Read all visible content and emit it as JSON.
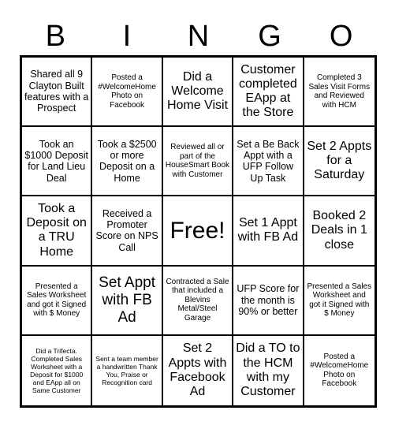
{
  "header": {
    "letters": [
      "B",
      "I",
      "N",
      "G",
      "O"
    ]
  },
  "grid": {
    "rows": 5,
    "columns": 5,
    "cells": [
      {
        "text": "Shared all 9 Clayton Built features with a Prospect",
        "size": "md"
      },
      {
        "text": "Posted a #WelcomeHome Photo on Facebook",
        "size": "sm"
      },
      {
        "text": "Did a Welcome Home Visit",
        "size": "lg"
      },
      {
        "text": "Customer completed EApp at the Store",
        "size": "lg"
      },
      {
        "text": "Completed 3 Sales Visit Forms and Reviewed with HCM",
        "size": "sm"
      },
      {
        "text": "Took an $1000 Deposit for Land Lieu Deal",
        "size": "md"
      },
      {
        "text": "Took a $2500 or more Deposit on a Home",
        "size": "md"
      },
      {
        "text": "Reviewed all or part of the HouseSmart Book with Customer",
        "size": "sm"
      },
      {
        "text": "Set a Be Back Appt with a UFP Follow Up Task",
        "size": "md"
      },
      {
        "text": "Set 2 Appts for a Saturday",
        "size": "lg"
      },
      {
        "text": "Took a Deposit on a TRU Home",
        "size": "lg"
      },
      {
        "text": "Received a Promoter Score on NPS Call",
        "size": "md"
      },
      {
        "text": "Free!",
        "size": "free"
      },
      {
        "text": "Set 1 Appt with FB Ad",
        "size": "lg"
      },
      {
        "text": "Booked 2 Deals in 1 close",
        "size": "lg"
      },
      {
        "text": "Presented a Sales Worksheet and got it Signed with $ Money",
        "size": "sm"
      },
      {
        "text": "Set Appt with FB Ad",
        "size": "xl"
      },
      {
        "text": "Contracted a Sale that included a Blevins Metal/Steel Garage",
        "size": "sm"
      },
      {
        "text": "UFP Score for the month is 90% or better",
        "size": "md"
      },
      {
        "text": "Presented a Sales Worksheet and got it Signed with $ Money",
        "size": "sm"
      },
      {
        "text": "Did a Trifecta. Completed Sales Worksheet with a Deposit for $1000 and EApp all on Same Customer",
        "size": "xs"
      },
      {
        "text": "Sent a team member a handwritten Thank You, Praise or Recognition card",
        "size": "xs"
      },
      {
        "text": "Set 2 Appts with Facebook Ad",
        "size": "lg"
      },
      {
        "text": "Did a TO to the HCM with my Customer",
        "size": "lg"
      },
      {
        "text": "Posted a #WelcomeHome Photo on Facebook",
        "size": "sm"
      }
    ]
  },
  "colors": {
    "border": "#000000",
    "background": "#ffffff",
    "text": "#000000"
  }
}
